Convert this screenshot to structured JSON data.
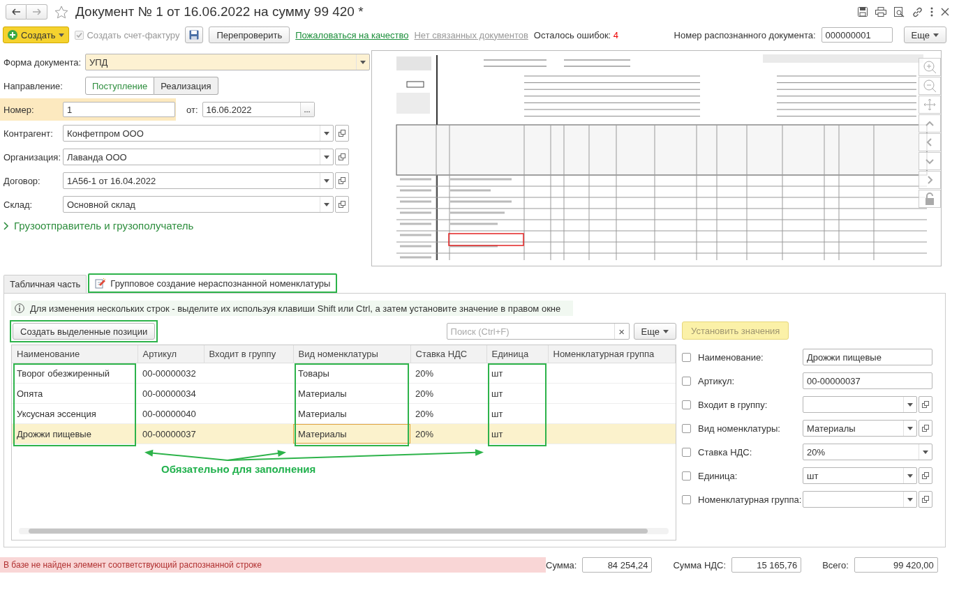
{
  "window": {
    "title": "Документ № 1 от 16.06.2022 на сумму 99 420 *"
  },
  "toolbar": {
    "create": "Создать",
    "invoice_checkbox": {
      "label": "Создать счет-фактуру",
      "checked": true,
      "disabled": true
    },
    "recheck": "Перепроверить",
    "complain_link": "Пожаловаться на качество",
    "related_link": "Нет связанных документов",
    "errors_label": "Осталось ошибок:",
    "errors_count": "4",
    "recognized_label": "Номер распознанного документа:",
    "recognized_number": "000000001",
    "more": "Еще"
  },
  "form": {
    "doc_form": {
      "label": "Форма документа:",
      "value": "УПД"
    },
    "direction": {
      "label": "Направление:",
      "options": [
        {
          "label": "Поступление",
          "selected": true
        },
        {
          "label": "Реализация",
          "selected": false
        }
      ]
    },
    "number": {
      "label": "Номер:",
      "value": "1",
      "date_label": "от:",
      "date": "16.06.2022",
      "date_button": "..."
    },
    "fields": [
      {
        "label": "Контрагент:",
        "value": "Конфетпром ООО"
      },
      {
        "label": "Организация:",
        "value": "Лаванда ООО"
      },
      {
        "label": "Договор:",
        "value": "1А56-1 от 16.04.2022"
      },
      {
        "label": "Склад:",
        "value": "Основной склад"
      }
    ],
    "group_link": {
      "label": "Грузоотправитель и грузополучатель",
      "expanded": false
    }
  },
  "tabs": [
    {
      "label": "Табличная часть",
      "selected": false,
      "highlighted": false,
      "icon": false
    },
    {
      "label": "Групповое создание нераспознанной номенклатуры",
      "selected": true,
      "highlighted": true,
      "icon": true
    }
  ],
  "panel": {
    "hint": "Для изменения нескольких строк - выделите их используя клавиши Shift или Ctrl, а затем установите значение в правом окне",
    "create_button": {
      "label": "Создать выделенные позиции",
      "highlighted": true
    },
    "search": {
      "placeholder": "Поиск (Ctrl+F)",
      "clear": "×"
    },
    "more": "Еще",
    "set_values": {
      "label": "Установить значения",
      "disabled": true
    }
  },
  "table": {
    "columns": [
      {
        "title": "Наименование",
        "required": true
      },
      {
        "title": "Артикул",
        "required": false
      },
      {
        "title": "Входит в группу",
        "required": false
      },
      {
        "title": "Вид номенклатуры",
        "required": true
      },
      {
        "title": "Ставка НДС",
        "required": false
      },
      {
        "title": "Единица",
        "required": true
      },
      {
        "title": "Номенклатурная группа",
        "required": false
      }
    ],
    "rows": [
      {
        "selected": false,
        "cells": [
          {
            "text": "Творог обезжиренный",
            "active": false
          },
          {
            "text": "00-00000032",
            "active": false
          },
          {
            "active": false
          },
          {
            "text": "Товары",
            "active": false
          },
          {
            "text": "20%",
            "active": false
          },
          {
            "text": "шт",
            "active": false
          },
          {
            "active": false
          }
        ]
      },
      {
        "selected": false,
        "cells": [
          {
            "text": "Опята",
            "active": false
          },
          {
            "text": "00-00000034",
            "active": false
          },
          {
            "active": false
          },
          {
            "text": "Материалы",
            "active": false
          },
          {
            "text": "20%",
            "active": false
          },
          {
            "text": "шт",
            "active": false
          },
          {
            "active": false
          }
        ]
      },
      {
        "selected": false,
        "cells": [
          {
            "text": "Уксусная эссенция",
            "active": false
          },
          {
            "text": "00-00000040",
            "active": false
          },
          {
            "active": false
          },
          {
            "text": "Материалы",
            "active": false
          },
          {
            "text": "20%",
            "active": false
          },
          {
            "text": "шт",
            "active": false
          },
          {
            "active": false
          }
        ]
      },
      {
        "selected": true,
        "cells": [
          {
            "text": "Дрожжи пищевые",
            "active": false
          },
          {
            "text": "00-00000037",
            "active": false
          },
          {
            "active": false
          },
          {
            "text": "Материалы",
            "active": true
          },
          {
            "text": "20%",
            "active": false
          },
          {
            "text": "шт",
            "active": false
          },
          {
            "active": false
          }
        ]
      }
    ]
  },
  "annotation": {
    "text": "Обязательно для заполнения"
  },
  "details": [
    {
      "label": "Наименование:",
      "checked": false,
      "kind": "text",
      "value": "Дрожжи пищевые"
    },
    {
      "label": "Артикул:",
      "checked": false,
      "kind": "text",
      "value": "00-00000037"
    },
    {
      "label": "Входит в группу:",
      "checked": false,
      "kind": "select_open"
    },
    {
      "label": "Вид номенклатуры:",
      "checked": false,
      "kind": "select_open",
      "value": "Материалы"
    },
    {
      "label": "Ставка НДС:",
      "checked": false,
      "kind": "select",
      "value": "20%"
    },
    {
      "label": "Единица:",
      "checked": false,
      "kind": "select_open",
      "value": "шт"
    },
    {
      "label": "Номенклатурная группа:",
      "checked": false,
      "kind": "select_open"
    }
  ],
  "status": {
    "message": "В базе не найден элемент соответствующий распознанной строке"
  },
  "totals": [
    {
      "label": "Сумма:",
      "value": "84 254,24"
    },
    {
      "label": "Сумма НДС:",
      "value": "15 165,76"
    },
    {
      "label": "Всего:",
      "value": "99 420,00"
    }
  ]
}
